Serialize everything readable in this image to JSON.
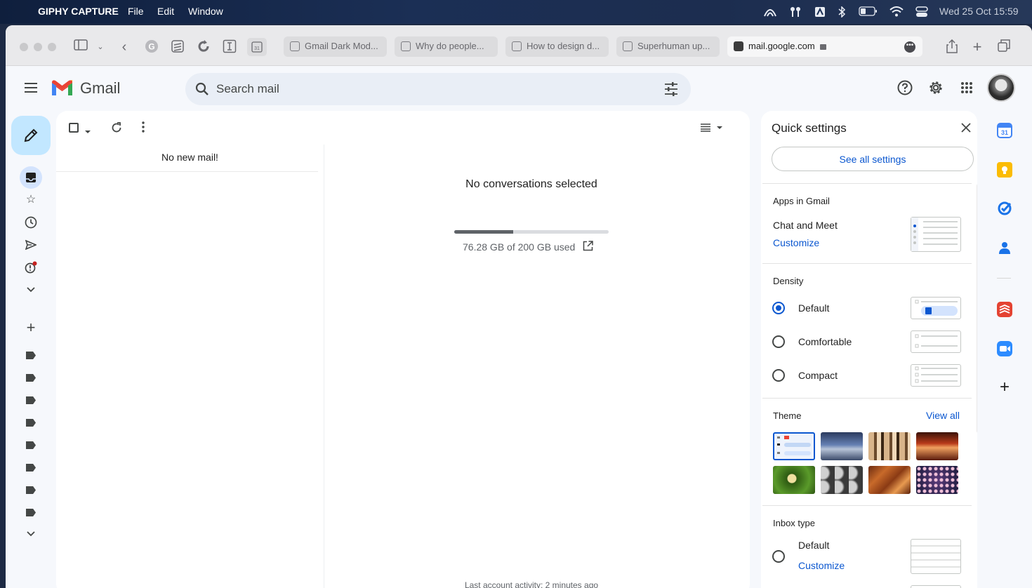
{
  "menubar": {
    "app_name": "GIPHY CAPTURE",
    "menus": [
      "File",
      "Edit",
      "Window"
    ],
    "datetime": "Wed 25 Oct  15:59"
  },
  "browser": {
    "tabs": [
      {
        "title": "Gmail Dark Mod..."
      },
      {
        "title": "Why do people..."
      },
      {
        "title": "How to design d..."
      },
      {
        "title": "Superhuman up..."
      }
    ],
    "address": "mail.google.com"
  },
  "gmail": {
    "logo_text": "Gmail",
    "search_placeholder": "Search mail",
    "no_new_mail": "No new mail!",
    "no_conversations": "No conversations selected",
    "storage": {
      "text": "76.28 GB of 200 GB used",
      "used_gb": 76.28,
      "total_gb": 200
    },
    "last_activity": "Last account activity: 2 minutes ago",
    "accent": "#0b57d0",
    "compose_bg": "#c2e7ff"
  },
  "quick_settings": {
    "title": "Quick settings",
    "see_all": "See all settings",
    "apps_heading": "Apps in Gmail",
    "chat_meet": "Chat and Meet",
    "customize": "Customize",
    "density_heading": "Density",
    "density_options": [
      {
        "label": "Default",
        "selected": true
      },
      {
        "label": "Comfortable",
        "selected": false
      },
      {
        "label": "Compact",
        "selected": false
      }
    ],
    "theme_heading": "Theme",
    "view_all": "View all",
    "inbox_heading": "Inbox type",
    "inbox_default": "Default",
    "inbox_customize": "Customize"
  }
}
